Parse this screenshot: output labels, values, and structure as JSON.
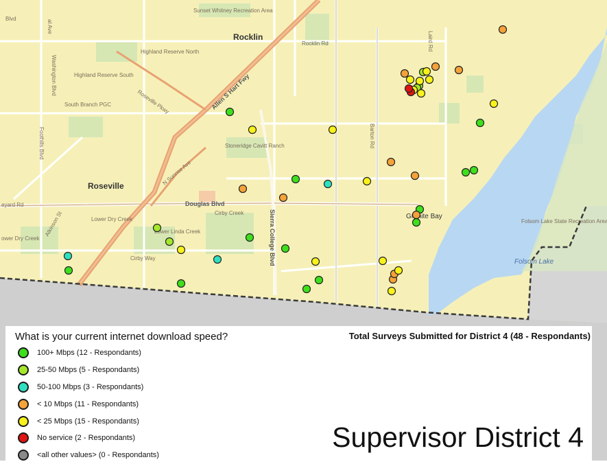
{
  "map": {
    "places": {
      "rocklin": "Rocklin",
      "roseville": "Roseville",
      "granite_bay": "Granite Bay",
      "highland_reserve_north": "Highland Reserve North",
      "highland_reserve_south": "Highland Reserve South",
      "south_branch_pgc": "South Branch PGC",
      "stoneridge": "Stoneridge Cavitt Ranch",
      "lower_dry_creek": "Lower Dry Creek",
      "lower_linda_creek": "Lower Linda Creek",
      "folsom_lake": "Folsom Lake",
      "folsom_lake_sra": "Folsom Lake State Recreation Area",
      "sunset_whitney": "Sunset Whitney Recreation Area",
      "ower_dry_creek": "ower Dry Creek"
    },
    "roads": {
      "allen_hart_fwy": "Allen S Hart Fwy",
      "douglas_blvd": "Douglas Blvd",
      "sierra_college_blvd": "Sierra College Blvd",
      "rocklin_rd": "Rocklin Rd",
      "laird_rd": "Laird Rd",
      "barton_rd": "Barton Rd",
      "cirby_creek": "Cirby Creek",
      "cirby_way": "Cirby Way",
      "roseville_pkwy": "Roseville Pkwy",
      "n_sunrise_ave": "N Sunrise Ave",
      "foothills_blvd": "Foothills Blvd",
      "washington_blvd": "Washington Blvd",
      "atkinson_st": "Atkinson St",
      "eyard_rd": "eyard Rd",
      "blvd": "Blvd",
      "al_ave": "al Ave"
    }
  },
  "legend": {
    "title": "What is your current internet download speed?",
    "total": "Total Surveys Submitted for District 4 (48 - Respondants)",
    "items": [
      {
        "label": "100+ Mbps (12 - Respondants)",
        "color": "#3ee01c"
      },
      {
        "label": "25-50 Mbps (5 - Respondants)",
        "color": "#a5e82b"
      },
      {
        "label": "50-100 Mbps (3 - Respondants)",
        "color": "#2fe0c0"
      },
      {
        "label": "< 10 Mbps (11 - Respondants)",
        "color": "#f4a23a"
      },
      {
        "label": "< 25 Mbps (15 - Respondants)",
        "color": "#f8f21a"
      },
      {
        "label": "No service (2 - Respondants)",
        "color": "#e01414"
      },
      {
        "label": "<all other values> (0 - Respondants)",
        "color": "#8a8a8a"
      }
    ]
  },
  "district_title": "Supervisor District 4"
}
